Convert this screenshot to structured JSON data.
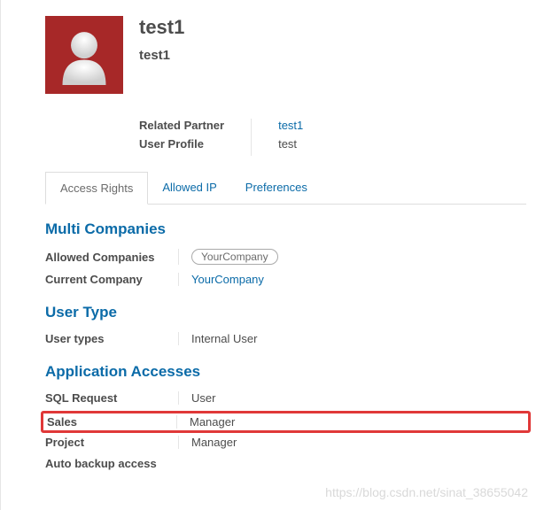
{
  "header": {
    "name_main": "test1",
    "name_sub": "test1"
  },
  "info": {
    "related_partner_label": "Related Partner",
    "related_partner_value": "test1",
    "user_profile_label": "User Profile",
    "user_profile_value": "test"
  },
  "tabs": {
    "access_rights": "Access Rights",
    "allowed_ip": "Allowed IP",
    "preferences": "Preferences"
  },
  "sections": {
    "multi_companies": {
      "title": "Multi Companies",
      "allowed_label": "Allowed Companies",
      "allowed_value": "YourCompany",
      "current_label": "Current Company",
      "current_value": "YourCompany"
    },
    "user_type": {
      "title": "User Type",
      "types_label": "User types",
      "types_value": "Internal User"
    },
    "app_accesses": {
      "title": "Application Accesses",
      "sql_label": "SQL Request",
      "sql_value": "User",
      "sales_label": "Sales",
      "sales_value": "Manager",
      "project_label": "Project",
      "project_value": "Manager",
      "backup_label": "Auto backup access"
    }
  },
  "watermark": "https://blog.csdn.net/sinat_38655042"
}
